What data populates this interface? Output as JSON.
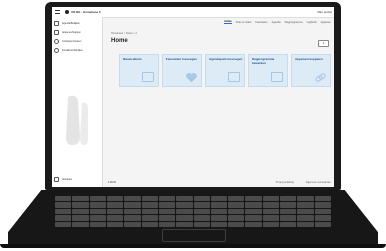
{
  "app": {
    "title": "UN BE - Homebase 6",
    "user": "Mijn profiel"
  },
  "tabs": [
    "Home",
    "Foto en video",
    "Favorieten",
    "Agenda",
    "Dagprogramma",
    "Logbook",
    "Appenen"
  ],
  "breadcrumb": "Homebase > Home > 2",
  "page_title": "Home",
  "header_button": "1",
  "sidebar": {
    "items": [
      "Agenda/Bekijken",
      "Appenen/Inappen",
      "Contacten/zoeken",
      "Fotoalbum/bekijken"
    ],
    "logout": "Afmelden"
  },
  "cards": [
    {
      "title": "Nieuw album",
      "icon": "photo-icon"
    },
    {
      "title": "Favorieten toevoegen",
      "icon": "heart-icon"
    },
    {
      "title": "Agendapunt toevoegen",
      "icon": "calendar-icon"
    },
    {
      "title": "Dagprogramma bewerken",
      "icon": "list-icon"
    },
    {
      "title": "Appenast koppelen",
      "icon": "link-icon"
    }
  ],
  "footer": {
    "left": "1.00.00",
    "right1": "Privacyverklaring",
    "right2": "Algemene voorwaarden"
  },
  "colors": {
    "accent": "#2a6ad9",
    "card_bg": "#ddebf6",
    "laptop": "#171717"
  }
}
